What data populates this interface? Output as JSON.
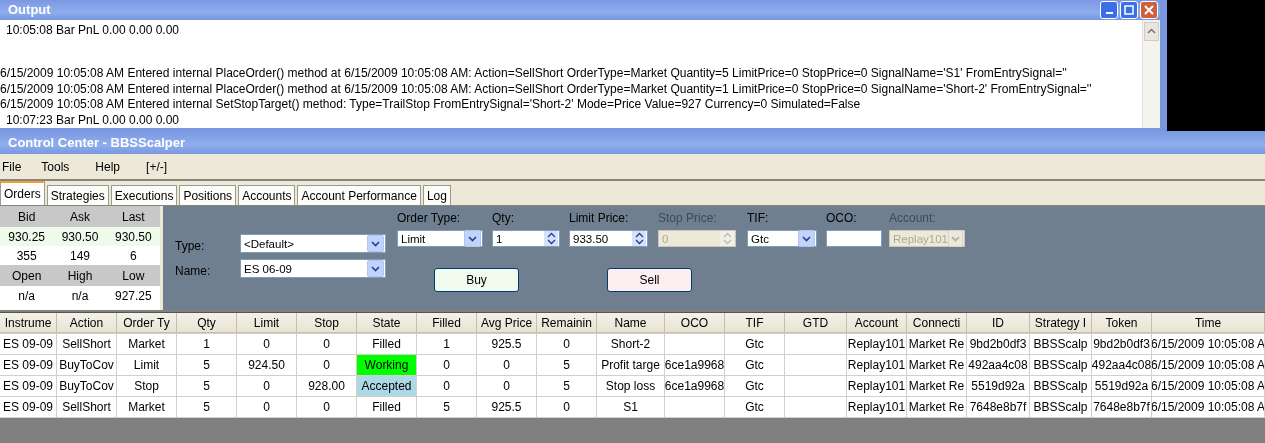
{
  "output_window": {
    "title": "Output",
    "lines": [
      "10:05:08 Bar  PnL  0.00  0.00  0.00",
      "6/15/2009 10:05:08 AM Entered internal PlaceOrder() method at 6/15/2009 10:05:08 AM: Action=SellShort OrderType=Market Quantity=5 LimitPrice=0 StopPrice=0 SignalName='S1' FromEntrySignal=''",
      "6/15/2009 10:05:08 AM Entered internal PlaceOrder() method at 6/15/2009 10:05:08 AM: Action=SellShort OrderType=Market Quantity=1 LimitPrice=0 StopPrice=0 SignalName='Short-2' FromEntrySignal=''",
      "6/15/2009 10:05:08 AM Entered internal SetStopTarget() method: Type=TrailStop FromEntrySignal='Short-2' Mode=Price Value=927 Currency=0 Simulated=False",
      "10:07:23 Bar  PnL  0.00  0.00  0.00"
    ]
  },
  "control_center": {
    "title": "Control Center - BBSScalper",
    "menu": [
      "File",
      "Tools",
      "Help",
      "[+/-]"
    ],
    "tabs": [
      {
        "label": "Orders",
        "selected": true
      },
      {
        "label": "Strategies",
        "selected": false
      },
      {
        "label": "Executions",
        "selected": false
      },
      {
        "label": "Positions",
        "selected": false
      },
      {
        "label": "Accounts",
        "selected": false
      },
      {
        "label": "Account Performance",
        "selected": false
      },
      {
        "label": "Log",
        "selected": false
      }
    ],
    "quote": [
      {
        "headers": [
          "Bid",
          "Ask",
          "Last"
        ],
        "rows": [
          {
            "values": [
              "930.25",
              "930.50",
              "930.50"
            ],
            "highlighted": true
          },
          {
            "values": [
              "355",
              "149",
              "6"
            ],
            "highlighted": false
          }
        ]
      },
      {
        "headers": [
          "Open",
          "High",
          "Low"
        ],
        "rows": [
          {
            "values": [
              "n/a",
              "n/a",
              "927.25"
            ],
            "highlighted": false
          }
        ]
      }
    ],
    "order_form": {
      "left_fields": [
        {
          "label": "Type:",
          "kind": "dropdown",
          "value": "<Default>",
          "disabled": false
        },
        {
          "label": "Name:",
          "kind": "dropdown",
          "value": "ES 06-09",
          "disabled": false
        }
      ],
      "fields": [
        {
          "label": "Order Type:",
          "kind": "dropdown",
          "value": "Limit",
          "disabled": false
        },
        {
          "label": "Qty:",
          "kind": "spinner",
          "value": "1",
          "disabled": false
        },
        {
          "label": "Limit Price:",
          "kind": "spinner",
          "value": "933.50",
          "disabled": false
        },
        {
          "label": "Stop Price:",
          "kind": "spinner",
          "value": "0",
          "disabled": true
        },
        {
          "label": "TIF:",
          "kind": "dropdown",
          "value": "Gtc",
          "disabled": false
        },
        {
          "label": "OCO:",
          "kind": "text",
          "disabled": false
        },
        {
          "label": "Account:",
          "kind": "dropdown",
          "value": "Replay101",
          "disabled": true
        }
      ],
      "buttons": [
        {
          "label": "Buy",
          "kind": "buy"
        },
        {
          "label": "Sell",
          "kind": "sell"
        }
      ]
    },
    "orders_table": {
      "columns": [
        "Instrume",
        "Action",
        "Order Ty",
        "Qty",
        "Limit",
        "Stop",
        "State",
        "Filled",
        "Avg Price",
        "Remainin",
        "Name",
        "OCO",
        "TIF",
        "GTD",
        "Account",
        "Connecti",
        "ID",
        "Strategy I",
        "Token",
        "Time"
      ],
      "rows": [
        {
          "cells": [
            "ES 09-09",
            "SellShort",
            "Market",
            "1",
            "0",
            "0",
            "Filled",
            "1",
            "925.5",
            "0",
            "Short-2",
            "",
            "Gtc",
            "",
            "Replay101",
            "Market Re",
            "9bd2b0df3",
            "BBSScalp",
            "9bd2b0df3",
            "6/15/2009 10:05:08 A"
          ]
        },
        {
          "cells": [
            "ES 09-09",
            "BuyToCov",
            "Limit",
            "5",
            "924.50",
            "0",
            "Working",
            "0",
            "0",
            "5",
            "Profit targe",
            "6ce1a9968",
            "Gtc",
            "",
            "Replay101",
            "Market Re",
            "492aa4c08",
            "BBSScalp",
            "492aa4c08",
            "6/15/2009 10:05:08 A"
          ],
          "color": "#00ff00"
        },
        {
          "cells": [
            "ES 09-09",
            "BuyToCov",
            "Stop",
            "5",
            "0",
            "928.00",
            "Accepted",
            "0",
            "0",
            "5",
            "Stop loss",
            "6ce1a9968",
            "Gtc",
            "",
            "Replay101",
            "Market Re",
            "5519d92a",
            "BBSScalp",
            "5519d92a",
            "6/15/2009 10:05:08 A"
          ],
          "color": "#add8e6"
        },
        {
          "cells": [
            "ES 09-09",
            "SellShort",
            "Market",
            "5",
            "0",
            "0",
            "Filled",
            "5",
            "925.5",
            "0",
            "S1",
            "",
            "Gtc",
            "",
            "Replay101",
            "Market Re",
            "7648e8b7f",
            "BBSScalp",
            "7648e8b7f",
            "6/15/2009 10:05:08 A"
          ]
        }
      ]
    }
  }
}
